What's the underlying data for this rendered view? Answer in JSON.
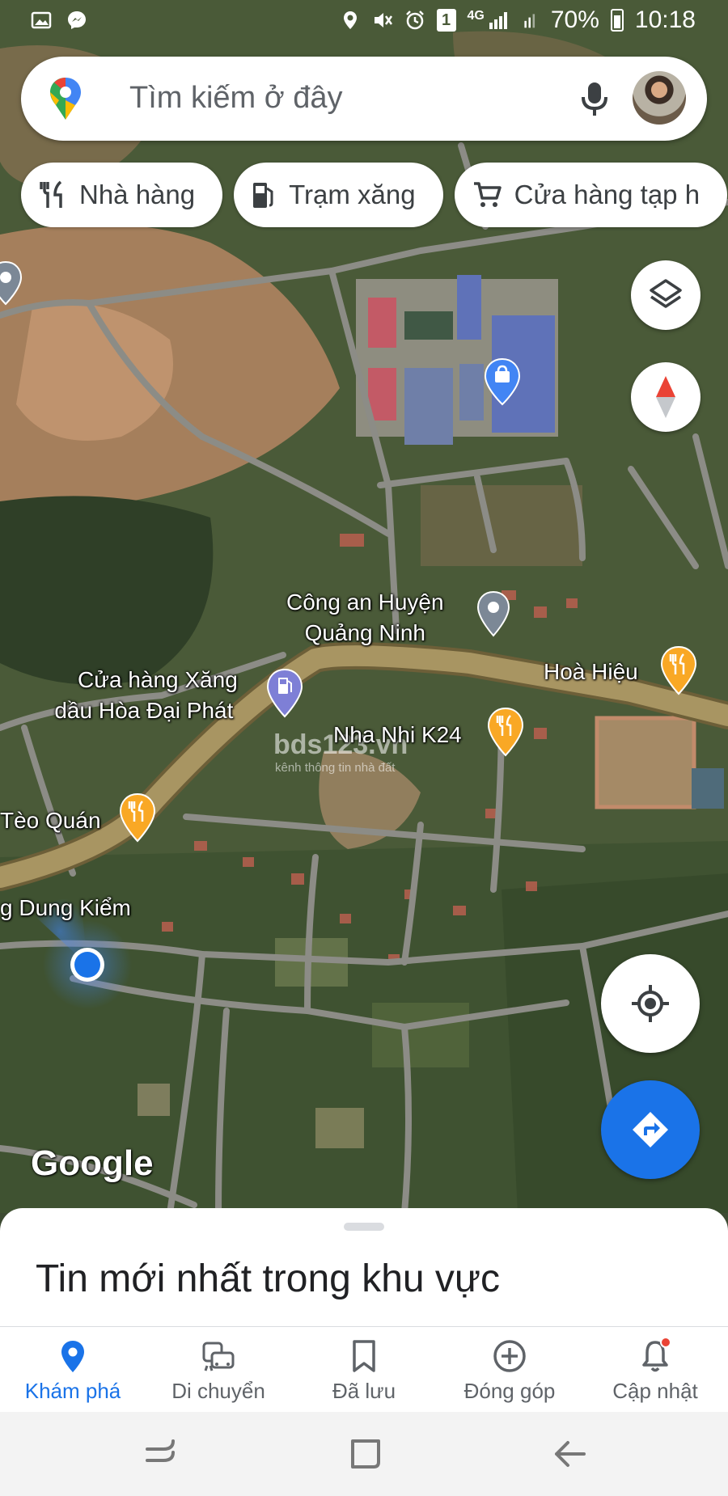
{
  "status_bar": {
    "battery": "70%",
    "time": "10:18",
    "network": "4G",
    "sim_slot": "1",
    "icons": [
      "gallery-icon",
      "messenger-icon",
      "location-icon",
      "vibrate-mute-icon",
      "alarm-icon",
      "sim-icon",
      "signal-icon",
      "battery-icon"
    ]
  },
  "search": {
    "placeholder": "Tìm kiếm ở đây",
    "icons": [
      "google-maps-logo",
      "mic-icon",
      "avatar"
    ]
  },
  "chips": [
    {
      "label": "Nhà hàng",
      "icon": "restaurant-icon"
    },
    {
      "label": "Trạm xăng",
      "icon": "gas-station-icon"
    },
    {
      "label": "Cửa hàng tạp h",
      "icon": "cart-icon"
    }
  ],
  "map": {
    "places": [
      {
        "name": "Công an Huyện Quảng Ninh",
        "line1": "Công an Huyện",
        "line2": "Quảng Ninh",
        "type": "government",
        "icon": "gray-pin-icon"
      },
      {
        "name": "Cửa hàng Xăng dầu Hòa Đại Phát",
        "line1": "Cửa hàng Xăng",
        "line2": "dầu Hòa Đại Phát",
        "type": "gas-station",
        "icon": "gas-pin-icon"
      },
      {
        "name": "Hoà Hiệu",
        "type": "restaurant",
        "icon": "restaurant-pin-icon"
      },
      {
        "name": "Nha Nhi K24",
        "type": "restaurant",
        "icon": "restaurant-pin-icon"
      },
      {
        "name": "Tèo Quán",
        "type": "restaurant",
        "icon": "restaurant-pin-icon"
      },
      {
        "name": "g Dung Kiểm",
        "type": "place"
      }
    ],
    "attribution": "Google",
    "watermark": {
      "line1": "bds123.vn",
      "line2": "kênh thông tin nhà đất"
    }
  },
  "controls": {
    "layers": "layers-icon",
    "compass": "compass-icon",
    "my_location": "my-location-icon",
    "directions": "directions-icon",
    "directions_color": "#1a73e8"
  },
  "sheet": {
    "title": "Tin mới nhất trong khu vực"
  },
  "bottom_nav": [
    {
      "label": "Khám phá",
      "icon": "explore-pin-icon",
      "active": true
    },
    {
      "label": "Di chuyển",
      "icon": "commute-icon",
      "active": false
    },
    {
      "label": "Đã lưu",
      "icon": "bookmark-icon",
      "active": false
    },
    {
      "label": "Đóng góp",
      "icon": "add-circle-icon",
      "active": false
    },
    {
      "label": "Cập nhật",
      "icon": "bell-icon",
      "active": false,
      "has_notification": true
    }
  ],
  "colors": {
    "accent": "#1a73e8",
    "restaurant_pin": "#f9a825",
    "notification": "#ea4335",
    "highway": "#a89562"
  }
}
